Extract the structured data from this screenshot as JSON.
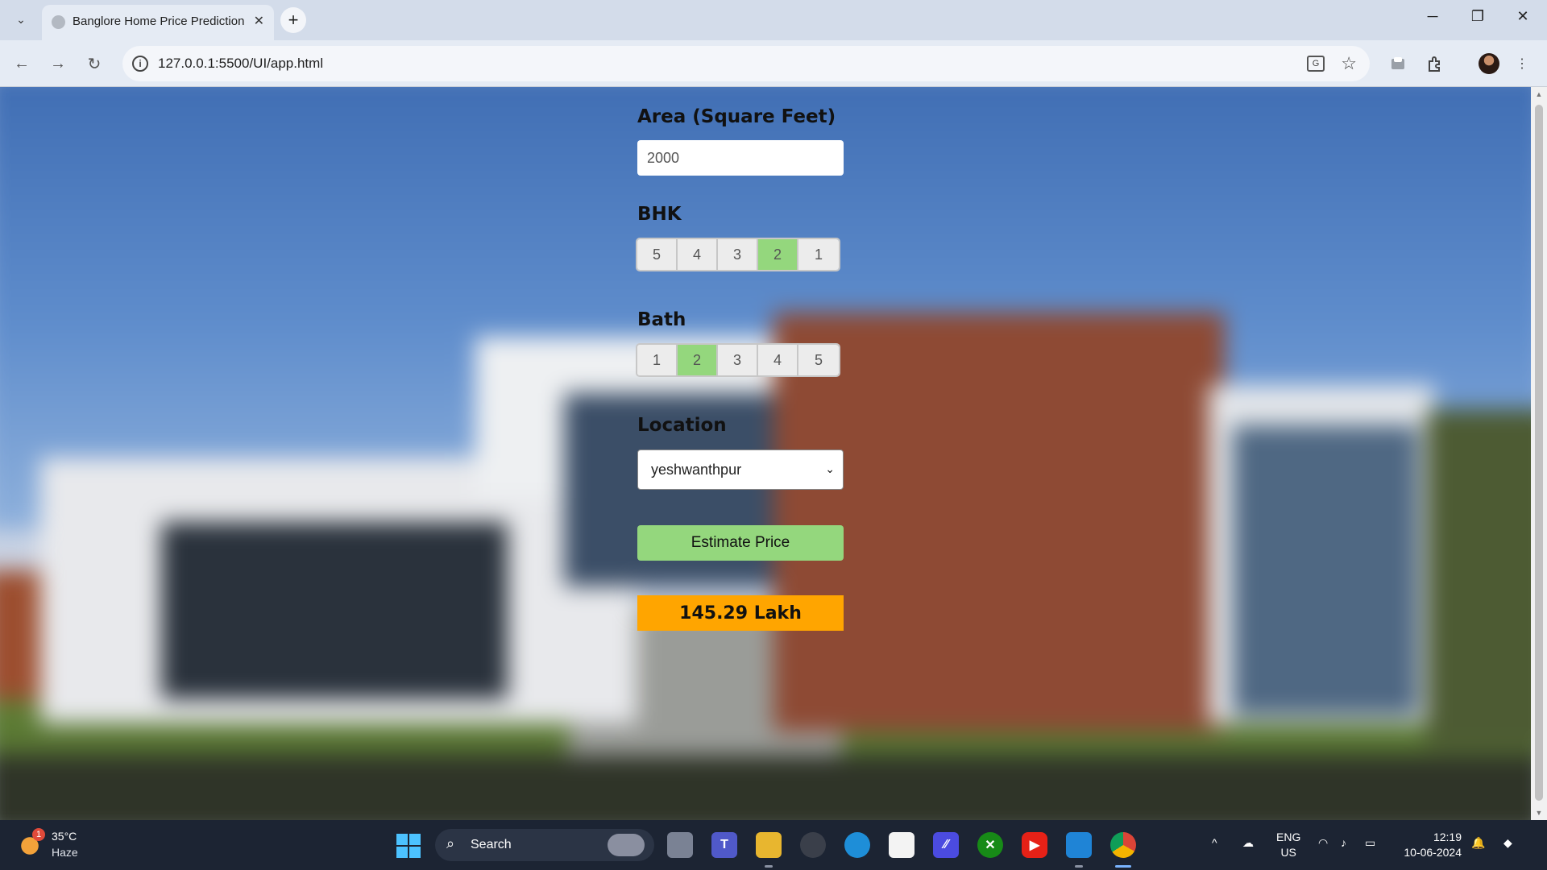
{
  "browser": {
    "tab_title": "Banglore Home Price Prediction",
    "new_tab": "+",
    "tab_close": "✕",
    "url_host": "127.0.0.1",
    "url_rest": ":5500/UI/app.html",
    "win_min": "─",
    "win_restore": "❐",
    "win_close": "✕"
  },
  "form": {
    "area_label": "Area (Square Feet)",
    "area_value": "2000",
    "bhk_label": "BHK",
    "bhk_options": [
      "5",
      "4",
      "3",
      "2",
      "1"
    ],
    "bhk_selected": "2",
    "bath_label": "Bath",
    "bath_options": [
      "1",
      "2",
      "3",
      "4",
      "5"
    ],
    "bath_selected": "2",
    "location_label": "Location",
    "location_value": "yeshwanthpur",
    "estimate_button": "Estimate Price",
    "result": "145.29 Lakh"
  },
  "colors": {
    "selected_option": "#94d77d",
    "estimate_button": "#94d77d",
    "result_bg": "#ffa500"
  },
  "taskbar": {
    "weather_temp": "35°C",
    "weather_desc": "Haze",
    "weather_badge": "1",
    "search_label": "Search",
    "lang_top": "ENG",
    "lang_bottom": "US",
    "time": "12:19",
    "date": "10-06-2024"
  }
}
